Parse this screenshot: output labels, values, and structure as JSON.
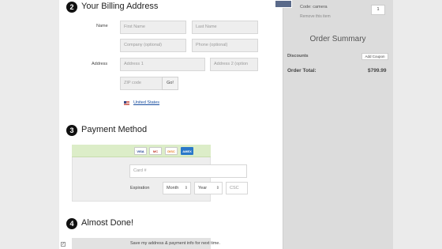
{
  "billing": {
    "step_number": "2",
    "title": "Your Billing Address",
    "name_label": "Name",
    "first_name_placeholder": "First Name",
    "last_name_placeholder": "Last Name",
    "company_placeholder": "Company (optional)",
    "phone_placeholder": "Phone (optional)",
    "address_label": "Address",
    "address1_placeholder": "Address 1",
    "address2_placeholder": "Address 2 (option",
    "zip_placeholder": "ZIP code",
    "go_label": "Go!",
    "country": "United States"
  },
  "payment": {
    "step_number": "3",
    "title": "Payment Method",
    "cards": [
      "VISA",
      "MC",
      "DISC",
      "AMEX"
    ],
    "card_placeholder": "Card #",
    "expiration_label": "Expiration",
    "month_label": "Month",
    "year_label": "Year",
    "csc_placeholder": "CSC"
  },
  "done": {
    "step_number": "4",
    "title": "Almost Done!",
    "save_text": "Save my address & payment info for next time."
  },
  "summary": {
    "code_text": "Code: camera",
    "remove_text": "Remove this item",
    "quantity": "1",
    "title": "Order Summary",
    "discounts_label": "Discounts",
    "add_coupon_label": "Add Coupon",
    "order_total_label": "Order Total:",
    "order_total_value": "$799.99"
  },
  "colors": {
    "cards_bar": "#dcedc8",
    "page_bg": "#ebebeb",
    "summary_bg": "#dcdcdc"
  }
}
